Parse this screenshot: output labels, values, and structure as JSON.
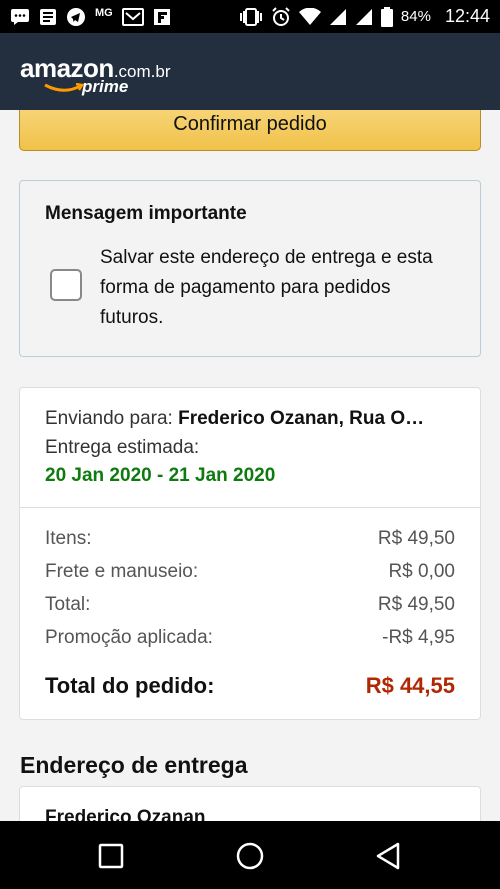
{
  "status_bar": {
    "network_label": "MG",
    "battery": "84%",
    "time": "12:44",
    "icons": [
      "chat-icon",
      "news-icon",
      "telegram-icon",
      "mail-icon",
      "flipboard-icon",
      "vibrate-icon",
      "alarm-icon",
      "wifi-icon",
      "signal-icon",
      "signal-icon",
      "battery-icon"
    ]
  },
  "header": {
    "brand": "amazon",
    "domain": ".com.br",
    "prime": "prime",
    "colors": {
      "background": "#232f3e",
      "smile": "#f90"
    }
  },
  "confirm_button": {
    "label": "Confirmar pedido"
  },
  "important_message": {
    "title": "Mensagem importante",
    "checkbox_text": "Salvar este endereço de entrega e esta forma de pagamento para pedidos futuros.",
    "checked": false
  },
  "order_summary": {
    "shipping_label": "Enviando para:",
    "shipping_to": "Frederico Ozanan, Rua O…",
    "estimated_label": "Entrega estimada:",
    "estimated_dates": "20 Jan 2020 - 21 Jan 2020",
    "rows": [
      {
        "label": "Itens:",
        "value": "R$ 49,50"
      },
      {
        "label": "Frete e manuseio:",
        "value": "R$ 0,00"
      },
      {
        "label": "Total:",
        "value": "R$ 49,50"
      },
      {
        "label": "Promoção aplicada:",
        "value": "-R$ 4,95"
      }
    ],
    "order_total_label": "Total do pedido:",
    "order_total_value": "R$ 44,55"
  },
  "delivery_address": {
    "title": "Endereço de entrega",
    "name": "Frederico Ozanan"
  },
  "nav_bar": {
    "buttons": [
      "recents-icon",
      "home-icon",
      "back-icon"
    ]
  }
}
